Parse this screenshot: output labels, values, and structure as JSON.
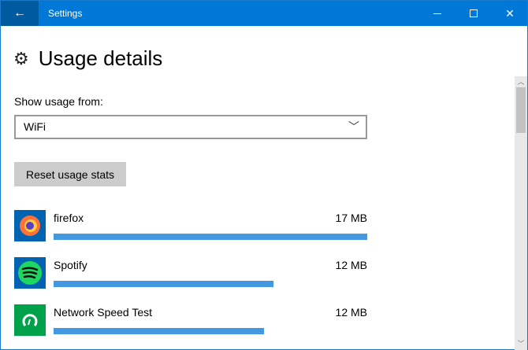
{
  "window": {
    "title": "Settings",
    "back": "←",
    "minimize": "—",
    "maximize": "☐",
    "close": "✕"
  },
  "page": {
    "title": "Usage details",
    "icon": "gear-icon"
  },
  "show_usage": {
    "label": "Show usage from:",
    "value": "WiFi"
  },
  "reset_button": "Reset usage stats",
  "apps": [
    {
      "name": "firefox",
      "size": "17 MB",
      "fraction": 1.0,
      "icon": "firefox-icon",
      "color": "#0063b1"
    },
    {
      "name": "Spotify",
      "size": "12 MB",
      "fraction": 0.7,
      "icon": "spotify-icon",
      "color": "#0063b1"
    },
    {
      "name": "Network Speed Test",
      "size": "12 MB",
      "fraction": 0.67,
      "icon": "speedometer-icon",
      "color": "#00a14b"
    }
  ]
}
